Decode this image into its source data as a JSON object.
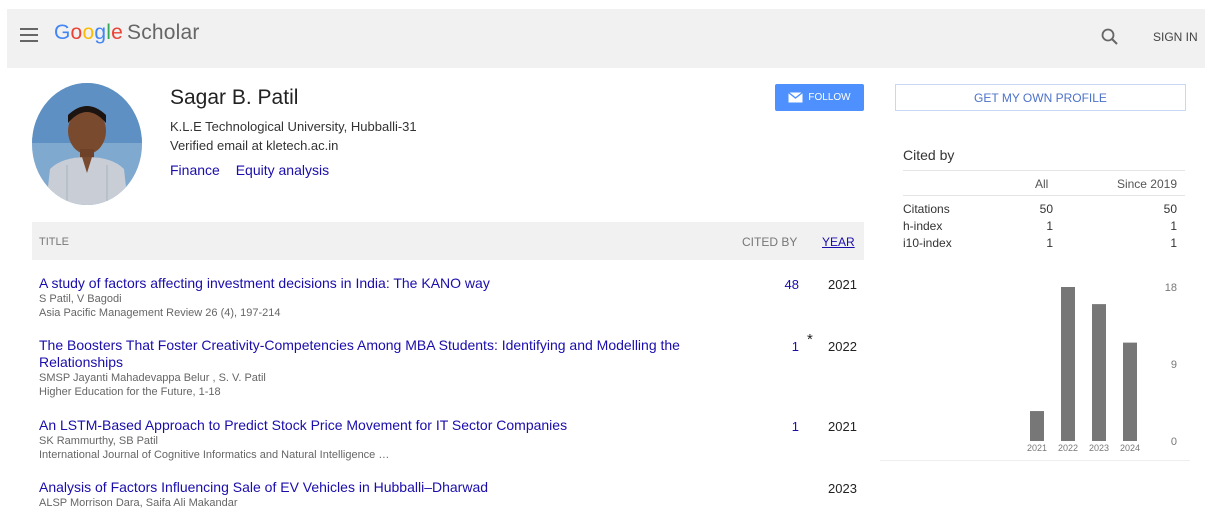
{
  "header": {
    "logo": {
      "G": "G",
      "o1": "o",
      "o2": "o",
      "g": "g",
      "l": "l",
      "e": "e",
      "scholar": "Scholar"
    },
    "sign_in": "SIGN IN"
  },
  "profile": {
    "name": "Sagar B. Patil",
    "affiliation": "K.L.E Technological University, Hubballi-31",
    "email": "Verified email at kletech.ac.in",
    "interests": [
      "Finance",
      "Equity analysis"
    ],
    "follow_label": "FOLLOW"
  },
  "table": {
    "col_title": "TITLE",
    "col_cited": "CITED BY",
    "col_year": "YEAR",
    "rows": [
      {
        "title": "A study of factors affecting investment decisions in India: The KANO way",
        "authors": "S Patil, V Bagodi",
        "venue": "Asia Pacific Management Review 26 (4), 197-214",
        "cited": "48",
        "star": "",
        "year": "2021"
      },
      {
        "title": "The Boosters That Foster Creativity-Competencies Among MBA Students: Identifying and Modelling the Relationships",
        "authors": "SMSP Jayanti Mahadevappa Belur , S. V. Patil",
        "venue": "Higher Education for the Future, 1-18",
        "cited": "1",
        "star": "*",
        "year": "2022"
      },
      {
        "title": "An LSTM-Based Approach to Predict Stock Price Movement for IT Sector Companies",
        "authors": "SK Rammurthy, SB Patil",
        "venue": "International Journal of Cognitive Informatics and Natural Intelligence …",
        "cited": "1",
        "star": "",
        "year": "2021"
      },
      {
        "title": "Analysis of Factors Influencing Sale of EV Vehicles in Hubballi–Dharwad",
        "authors": "ALSP Morrison Dara, Saifa Ali Makandar",
        "venue": "",
        "cited": "",
        "star": "",
        "year": "2023"
      }
    ]
  },
  "sidebar": {
    "own_profile": "GET MY OWN PROFILE",
    "cited_by": "Cited by",
    "col_all": "All",
    "col_since": "Since 2019",
    "stats": [
      {
        "label": "Citations",
        "all": "50",
        "since": "50"
      },
      {
        "label": "h-index",
        "all": "1",
        "since": "1"
      },
      {
        "label": "i10-index",
        "all": "1",
        "since": "1"
      }
    ]
  },
  "chart_data": {
    "type": "bar",
    "categories": [
      "2021",
      "2022",
      "2023",
      "2024"
    ],
    "values": [
      3.5,
      18,
      16,
      11.5
    ],
    "ylim": [
      0,
      18
    ],
    "yticks": [
      "0",
      "9",
      "18"
    ],
    "bar_color": "#777777",
    "grid": false,
    "y_axis_side": "right"
  },
  "colors": {
    "link": "#1a0dab",
    "follow_button": "#4d90fe",
    "topbar": "#f1f1f1"
  }
}
